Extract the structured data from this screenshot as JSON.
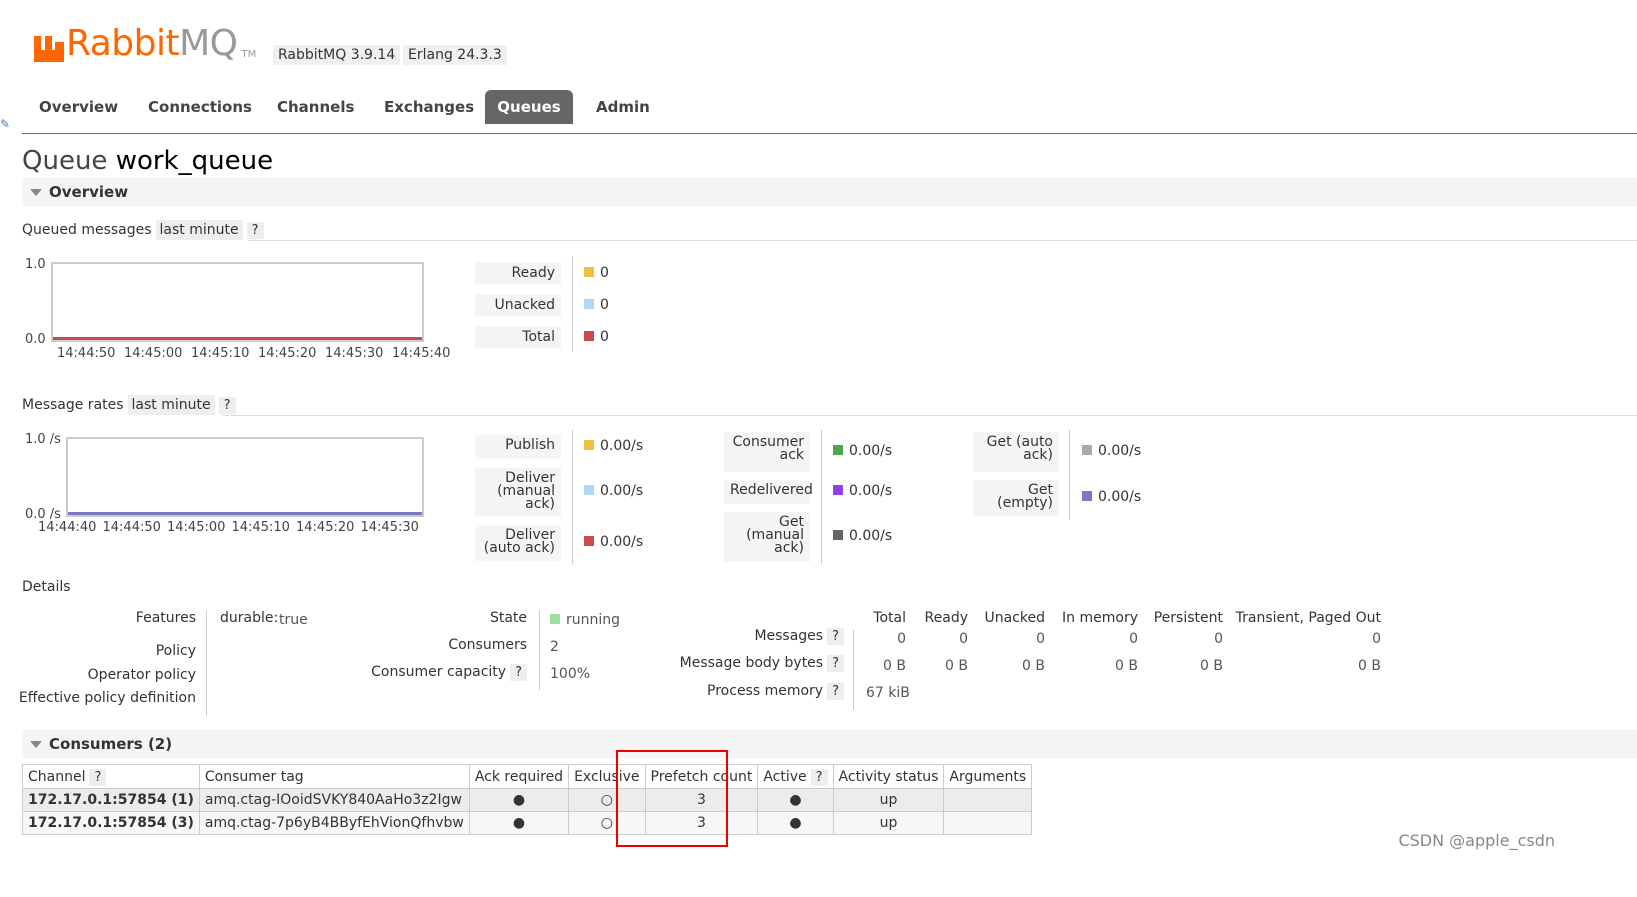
{
  "header": {
    "brand_rabbit": "Rabbit",
    "brand_mq": "MQ",
    "brand_tm": "TM",
    "version": "RabbitMQ 3.9.14",
    "erlang": "Erlang 24.3.3"
  },
  "nav": [
    "Overview",
    "Connections",
    "Channels",
    "Exchanges",
    "Queues",
    "Admin"
  ],
  "page": {
    "title_prefix": "Queue",
    "title_name": "work_queue"
  },
  "overview": {
    "section_label": "Overview",
    "queued": {
      "heading": "Queued messages",
      "range": "last minute",
      "help": "?",
      "y_top": "1.0",
      "y_bottom": "0.0",
      "x_ticks": [
        "14:44:50",
        "14:45:00",
        "14:45:10",
        "14:45:20",
        "14:45:30",
        "14:45:40"
      ],
      "legend": [
        {
          "label": "Ready",
          "value": "0",
          "color": "#edc240"
        },
        {
          "label": "Unacked",
          "value": "0",
          "color": "#afd8f8"
        },
        {
          "label": "Total",
          "value": "0",
          "color": "#cb4b4b"
        }
      ]
    },
    "rates": {
      "heading": "Message rates",
      "range": "last minute",
      "help": "?",
      "y_top": "1.0 /s",
      "y_bottom": "0.0 /s",
      "x_ticks": [
        "14:44:40",
        "14:44:50",
        "14:45:00",
        "14:45:10",
        "14:45:20",
        "14:45:30"
      ],
      "col1": [
        {
          "label": "Publish",
          "value": "0.00/s",
          "color": "#edc240"
        },
        {
          "label": "Deliver (manual ack)",
          "value": "0.00/s",
          "color": "#afd8f8"
        },
        {
          "label": "Deliver (auto ack)",
          "value": "0.00/s",
          "color": "#cb4b4b"
        }
      ],
      "col2": [
        {
          "label": "Consumer ack",
          "value": "0.00/s",
          "color": "#4da74d"
        },
        {
          "label": "Redelivered",
          "value": "0.00/s",
          "color": "#9440ed"
        },
        {
          "label": "Get (manual ack)",
          "value": "0.00/s",
          "color": "#666666"
        }
      ],
      "col3": [
        {
          "label": "Get (auto ack)",
          "value": "0.00/s",
          "color": "#aaaaaa"
        },
        {
          "label": "Get (empty)",
          "value": "0.00/s",
          "color": "#7c79c3"
        }
      ]
    }
  },
  "details": {
    "heading": "Details",
    "features_label": "Features",
    "durable_key": "durable:",
    "durable_val": "true",
    "policy_label": "Policy",
    "operator_policy_label": "Operator policy",
    "effective_policy_label": "Effective policy definition",
    "state_label": "State",
    "state_val": "running",
    "state_color": "#9de09d",
    "consumers_label": "Consumers",
    "consumers_val": "2",
    "capacity_label": "Consumer capacity",
    "capacity_help": "?",
    "capacity_val": "100%",
    "stats_headers": [
      "Total",
      "Ready",
      "Unacked",
      "In memory",
      "Persistent",
      "Transient, Paged Out"
    ],
    "messages_label": "Messages",
    "messages_vals": [
      "0",
      "0",
      "0",
      "0",
      "0",
      "0"
    ],
    "body_bytes_label": "Message body bytes",
    "body_bytes_vals": [
      "0 B",
      "0 B",
      "0 B",
      "0 B",
      "0 B",
      "0 B"
    ],
    "process_memory_label": "Process memory",
    "process_memory_val": "67 kiB",
    "help": "?"
  },
  "consumers": {
    "section_label": "Consumers (2)",
    "headers": {
      "channel": "Channel",
      "tag": "Consumer tag",
      "ack": "Ack required",
      "exclusive": "Exclusive",
      "prefetch": "Prefetch count",
      "active": "Active",
      "status": "Activity status",
      "args": "Arguments",
      "help": "?"
    },
    "rows": [
      {
        "channel": "172.17.0.1:57854 (1)",
        "tag": "amq.ctag-IOoidSVKY840AaHo3z2Igw",
        "ack": "●",
        "exclusive": "○",
        "prefetch": "3",
        "active": "●",
        "status": "up",
        "args": ""
      },
      {
        "channel": "172.17.0.1:57854 (3)",
        "tag": "amq.ctag-7p6yB4BByfEhVionQfhvbw",
        "ack": "●",
        "exclusive": "○",
        "prefetch": "3",
        "active": "●",
        "status": "up",
        "args": ""
      }
    ]
  },
  "watermark": "CSDN @apple_csdn"
}
